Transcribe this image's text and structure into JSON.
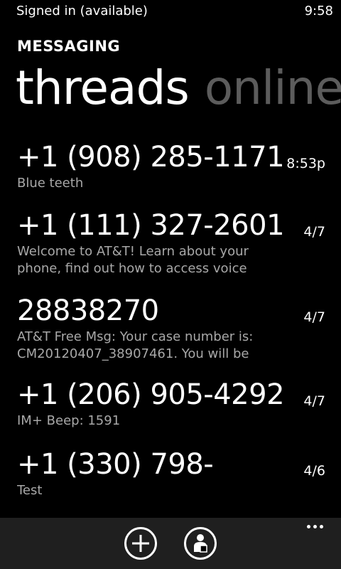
{
  "status": {
    "left_text": "Signed in (available)",
    "clock": "9:58"
  },
  "app": {
    "title": "MESSAGING"
  },
  "pivot": {
    "items": [
      "threads",
      "online"
    ],
    "active": "threads"
  },
  "threads": [
    {
      "title": "+1 (908) 285-1171",
      "time": "8:53p",
      "preview": [
        "Blue teeth"
      ]
    },
    {
      "title": "+1 (111) 327-2601",
      "time": "4/7",
      "preview": [
        "Welcome to AT&T! Learn about your",
        "phone, find out how to access voice"
      ]
    },
    {
      "title": "28838270",
      "time": "4/7",
      "preview": [
        "AT&T Free Msg: Your case number is:",
        "CM20120407_38907461. You will be"
      ]
    },
    {
      "title": "+1 (206) 905-4292",
      "time": "4/7",
      "preview": [
        "IM+ Beep: 1591"
      ]
    },
    {
      "title": "+1 (330) 798-",
      "time": "4/6",
      "preview": [
        "Test"
      ]
    }
  ],
  "app_bar": {
    "buttons": [
      {
        "icon": "add-icon"
      },
      {
        "icon": "contact-icon"
      }
    ],
    "more_icon": "ellipsis-icon"
  },
  "colors": {
    "background": "#000000",
    "app_bar": "#1f1f1f",
    "text": "#ffffff",
    "secondary_text": "#a8a8a8",
    "inactive_pivot": "#5c5c5c"
  }
}
